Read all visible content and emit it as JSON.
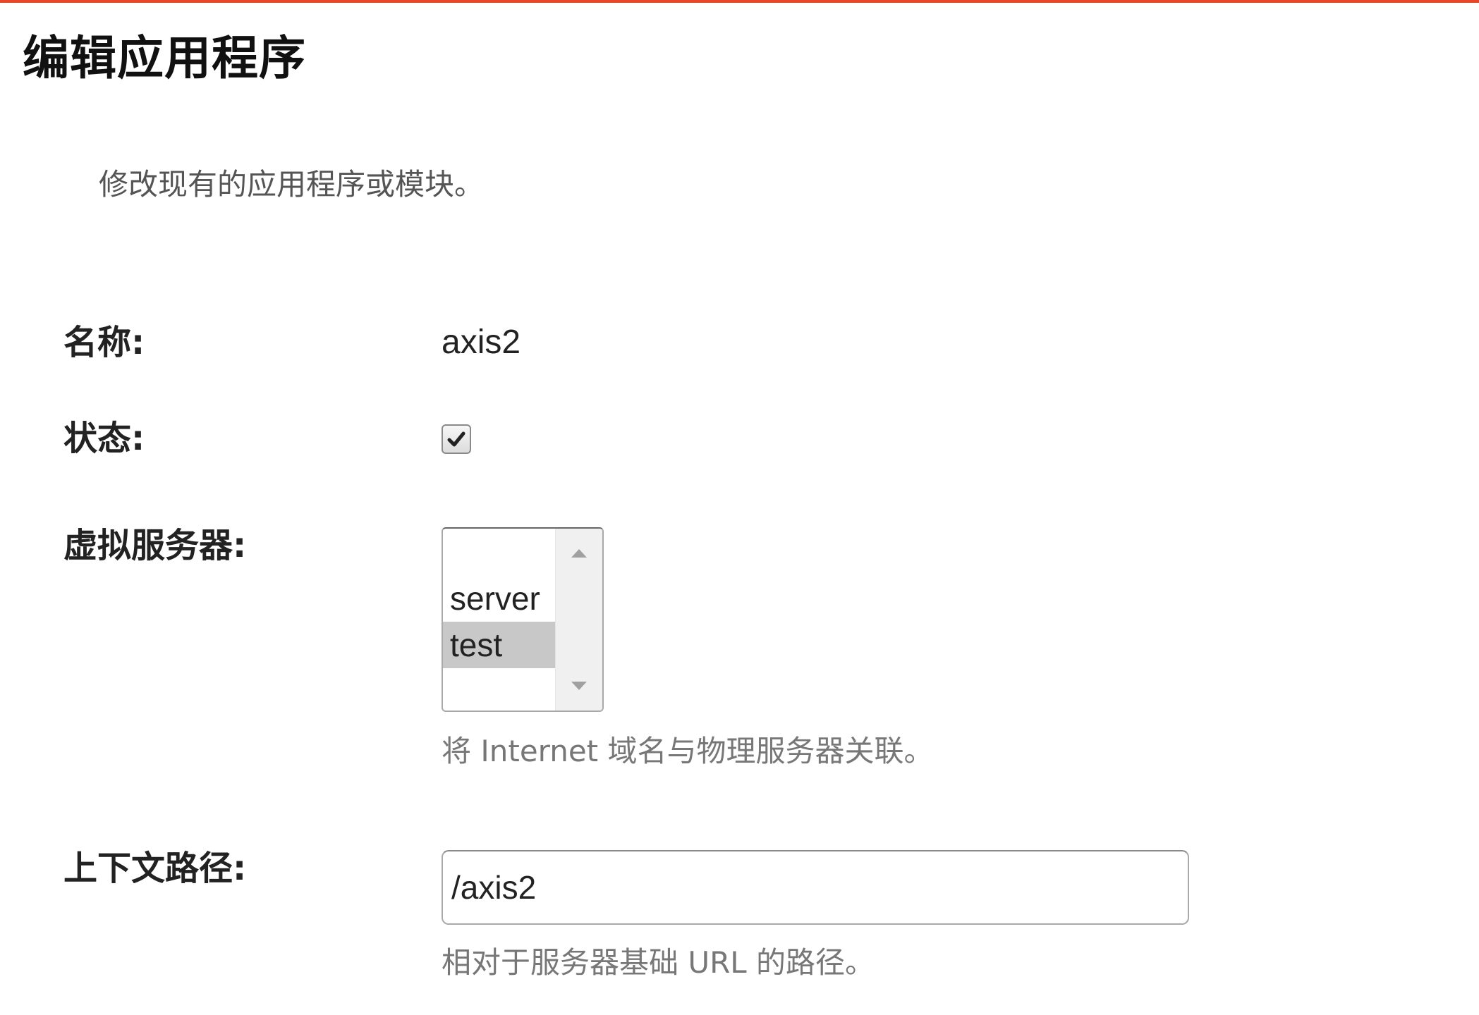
{
  "page": {
    "title": "编辑应用程序",
    "description": "修改现有的应用程序或模块。",
    "accent_color": "#e8452b"
  },
  "form": {
    "name": {
      "label": "名称:",
      "value": "axis2"
    },
    "status": {
      "label": "状态:",
      "checked": true
    },
    "virtual_servers": {
      "label": "虚拟服务器:",
      "options": [
        {
          "label": "server",
          "selected": false
        },
        {
          "label": "test",
          "selected": true
        }
      ],
      "hint": "将 Internet 域名与物理服务器关联。"
    },
    "context_path": {
      "label": "上下文路径:",
      "value": "/axis2",
      "hint": "相对于服务器基础 URL 的路径。"
    }
  },
  "icons": {
    "checkbox_mark": "checkmark-icon",
    "scroll_up": "triangle-up-icon",
    "scroll_down": "triangle-down-icon"
  }
}
